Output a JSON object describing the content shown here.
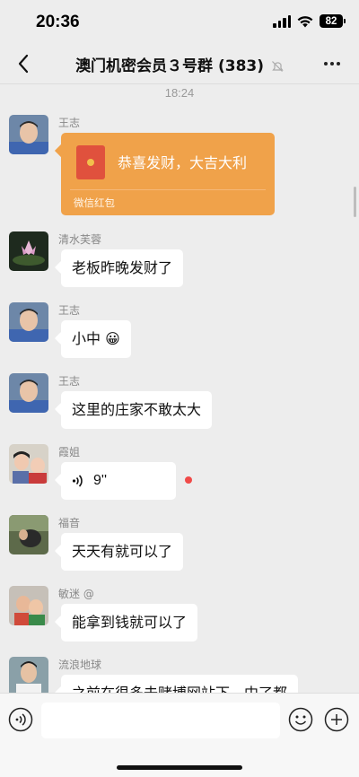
{
  "status_bar": {
    "time": "20:36",
    "battery": "82"
  },
  "nav": {
    "title": "澳门机密会员３号群 (383)"
  },
  "chat": {
    "timestamp": "18:24",
    "messages": [
      {
        "sender": "王志",
        "type": "red_packet",
        "title": "恭喜发财，大吉大利",
        "footer": "微信红包"
      },
      {
        "sender": "清水芙蓉",
        "type": "text",
        "text": "老板昨晚发财了"
      },
      {
        "sender": "王志",
        "type": "text",
        "text": "小中",
        "emoji": "😀"
      },
      {
        "sender": "王志",
        "type": "text",
        "text": "这里的庄家不敢太大"
      },
      {
        "sender": "霞姐",
        "type": "voice",
        "duration": "9''"
      },
      {
        "sender": "福音",
        "type": "text",
        "text": "天天有就可以了"
      },
      {
        "sender": "敏迷 @",
        "type": "text",
        "text": "能拿到钱就可以了"
      },
      {
        "sender": "流浪地球",
        "type": "text",
        "text": "之前在很多去赌博网站下，中了都"
      }
    ]
  },
  "input_bar": {
    "voice_icon": "voice-icon",
    "emoji_icon": "emoji-icon",
    "add_icon": "plus-icon"
  },
  "colors": {
    "background": "#ededed",
    "red_packet": "#f0a24a",
    "bubble": "#ffffff",
    "unread": "#f04a48"
  }
}
